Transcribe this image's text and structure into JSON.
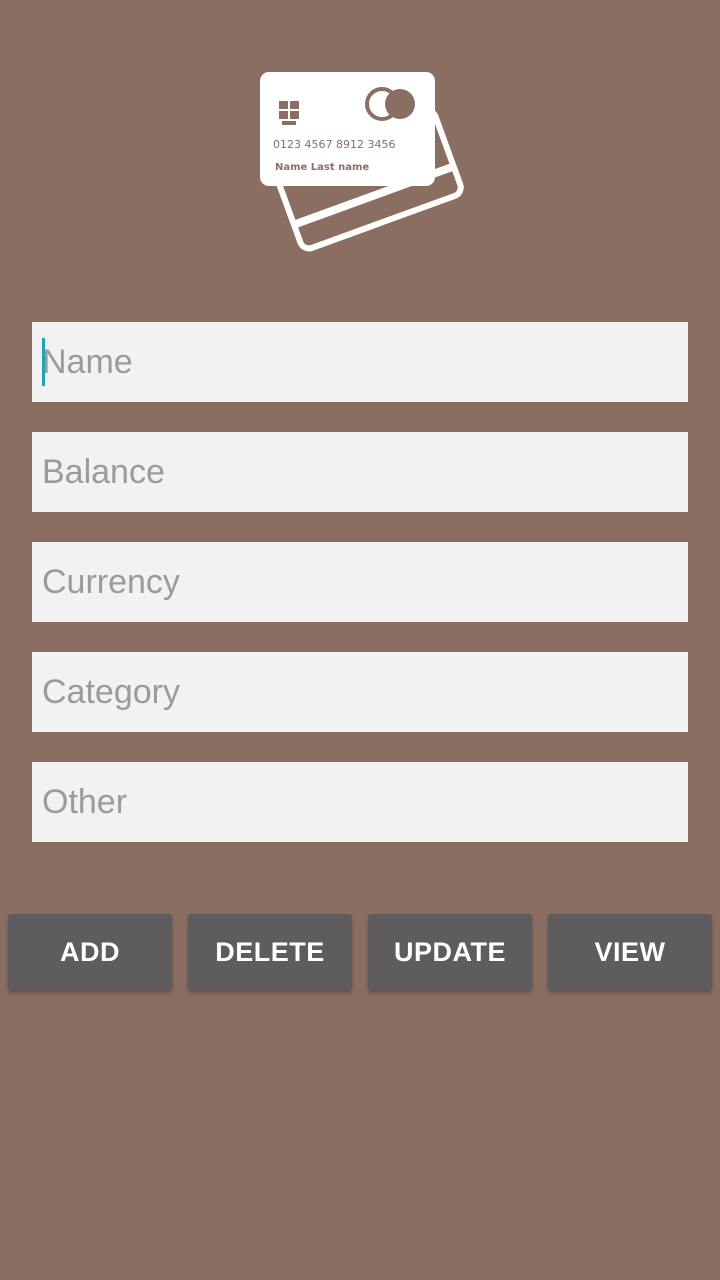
{
  "logo": {
    "icon": "credit-cards-icon",
    "card_number": "0123 4567 8912 3456",
    "card_holder": "Name Last name"
  },
  "form": {
    "name": {
      "value": "",
      "placeholder": "Name"
    },
    "balance": {
      "value": "",
      "placeholder": "Balance"
    },
    "currency": {
      "value": "",
      "placeholder": "Currency"
    },
    "category": {
      "value": "",
      "placeholder": "Category"
    },
    "other": {
      "value": "",
      "placeholder": "Other"
    }
  },
  "buttons": {
    "add": "ADD",
    "delete": "DELETE",
    "update": "UPDATE",
    "view": "VIEW"
  },
  "colors": {
    "background": "#8b6e62",
    "field_bg": "#f2f2f2",
    "placeholder": "#9b9b9b",
    "button_bg": "#5e5c5f",
    "button_text": "#ffffff",
    "cursor": "#1fa3b8"
  }
}
